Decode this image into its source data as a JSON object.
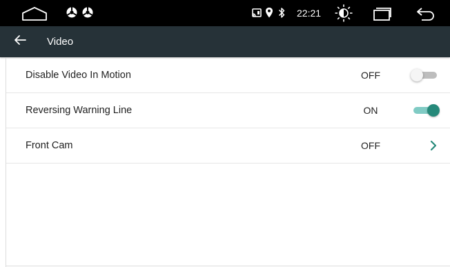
{
  "status_bar": {
    "time": "22:21",
    "icons": [
      "home-icon",
      "steering-wheel-icon",
      "steering-wheel-icon",
      "cast-icon",
      "location-pin-icon",
      "bluetooth-icon",
      "brightness-icon",
      "recent-apps-icon",
      "back-arrow-icon"
    ]
  },
  "header": {
    "title": "Video",
    "back_icon": "back-arrow-icon"
  },
  "settings": [
    {
      "label": "Disable Video In Motion",
      "value": "OFF",
      "control": "toggle",
      "state": "off"
    },
    {
      "label": "Reversing Warning Line",
      "value": "ON",
      "control": "toggle",
      "state": "on"
    },
    {
      "label": "Front Cam",
      "value": "OFF",
      "control": "chevron"
    }
  ],
  "colors": {
    "status_bar_bg": "#000000",
    "app_bar_bg": "#263238",
    "accent": "#26897a",
    "accent_track": "#80cbc4",
    "divider": "#e6e6e6"
  }
}
